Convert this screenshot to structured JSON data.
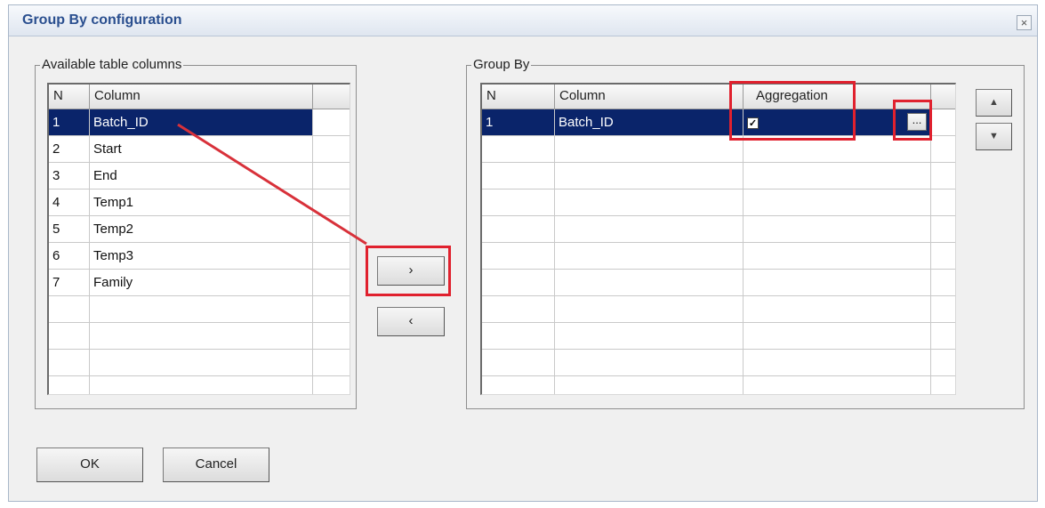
{
  "window": {
    "title": "Group By configuration",
    "close_glyph": "×"
  },
  "available": {
    "label": "Available table columns",
    "headers": [
      "N",
      "Column",
      ""
    ],
    "rows": [
      {
        "n": "1",
        "column": "Batch_ID"
      },
      {
        "n": "2",
        "column": "Start"
      },
      {
        "n": "3",
        "column": "End"
      },
      {
        "n": "4",
        "column": "Temp1"
      },
      {
        "n": "5",
        "column": "Temp2"
      },
      {
        "n": "6",
        "column": "Temp3"
      },
      {
        "n": "7",
        "column": "Family"
      }
    ],
    "selected_row": "1"
  },
  "transfer": {
    "add_glyph": "›",
    "remove_glyph": "‹"
  },
  "groupby": {
    "label": "Group By",
    "headers": [
      "N",
      "Column",
      "Aggregation",
      ""
    ],
    "rows": [
      {
        "n": "1",
        "column": "Batch_ID",
        "aggregation": true,
        "ellipsis": "..."
      }
    ]
  },
  "order": {
    "up_glyph": "▲",
    "down_glyph": "▼"
  },
  "footer": {
    "ok_label": "OK",
    "cancel_label": "Cancel"
  },
  "colors": {
    "selection": "#0a246a",
    "highlight": "#e0212e",
    "title": "#2a4f8f"
  },
  "icons": {
    "close": "close-icon",
    "add": "right-arrow-icon",
    "remove": "left-arrow-icon",
    "up": "up-arrow-icon",
    "down": "down-arrow-icon"
  }
}
